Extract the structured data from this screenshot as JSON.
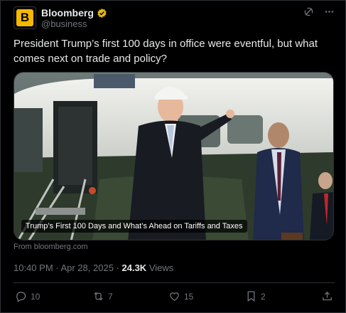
{
  "account": {
    "avatar_letter": "B",
    "name": "Bloomberg",
    "handle": "@business",
    "brand_color": "#f5b800",
    "verified_badge_color": "#e2b719"
  },
  "header_icons": [
    "grok-icon",
    "more-icon"
  ],
  "tweet": {
    "text": "President Trump’s first 100 days in office were eventful, but what comes next on trade and policy?",
    "media_caption": "Trump’s First 100 Days and What’s Ahead on Tariffs and Taxes",
    "source": "From bloomberg.com",
    "time": "10:40 PM · Apr 28, 2025",
    "separator": " · ",
    "views_count": "24.3K",
    "views_label": " Views"
  },
  "actions": {
    "replies": "10",
    "reposts": "7",
    "likes": "15",
    "bookmarks": "2"
  }
}
